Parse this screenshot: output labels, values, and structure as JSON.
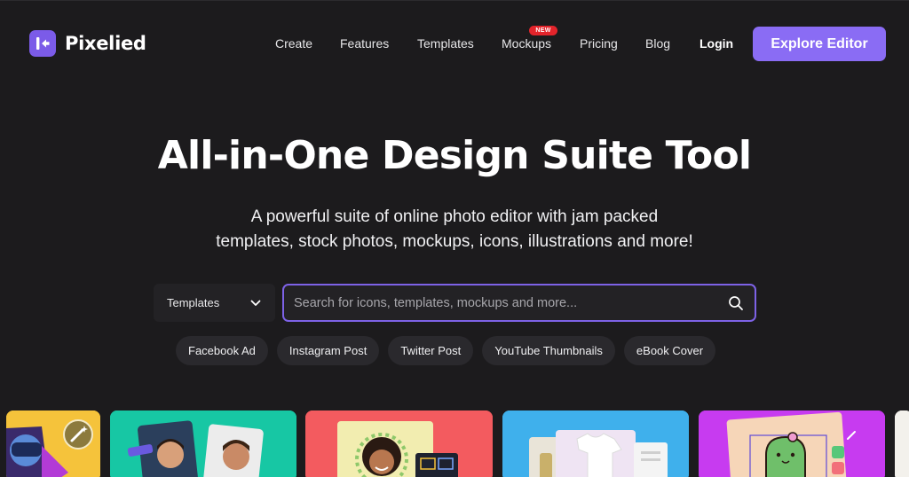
{
  "brand": {
    "name": "Pixelied",
    "accent": "#8a6cf4"
  },
  "nav": {
    "items": [
      {
        "label": "Create"
      },
      {
        "label": "Features"
      },
      {
        "label": "Templates"
      },
      {
        "label": "Mockups",
        "badge": "NEW"
      },
      {
        "label": "Pricing"
      },
      {
        "label": "Blog"
      },
      {
        "label": "Login"
      }
    ],
    "cta": "Explore Editor"
  },
  "hero": {
    "title": "All-in-One Design Suite Tool",
    "subtitle_line1": "A powerful suite of online photo editor with jam packed",
    "subtitle_line2": "templates, stock photos, mockups, icons, illustrations and more!"
  },
  "search": {
    "category": "Templates",
    "placeholder": "Search for icons, templates, mockups and more..."
  },
  "chips": [
    "Facebook Ad",
    "Instagram Post",
    "Twitter Post",
    "YouTube Thumbnails",
    "eBook Cover"
  ],
  "cards": [
    {
      "color": "#f5c33b"
    },
    {
      "color": "#17c7a4"
    },
    {
      "color": "#f35b5f"
    },
    {
      "color": "#3fb0ec"
    },
    {
      "color": "#c73bf0"
    }
  ]
}
